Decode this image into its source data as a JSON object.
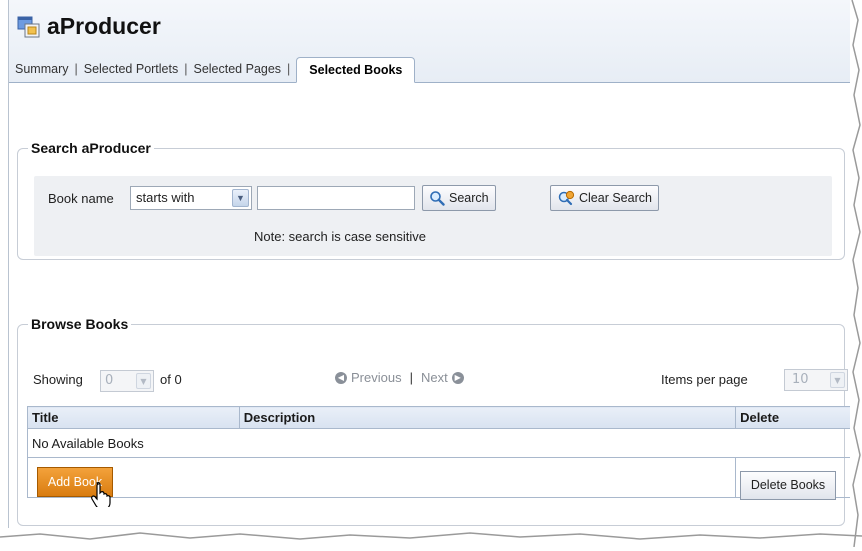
{
  "app": {
    "title": "aProducer",
    "icon": "application-icon"
  },
  "tabs": [
    {
      "label": "Summary",
      "active": false
    },
    {
      "label": "Selected Portlets",
      "active": false
    },
    {
      "label": "Selected Pages",
      "active": false
    },
    {
      "label": "Selected Books",
      "active": true
    }
  ],
  "search": {
    "legend": "Search aProducer",
    "field_label": "Book name",
    "match_mode": "starts with",
    "query_value": "",
    "search_label": "Search",
    "clear_label": "Clear Search",
    "note": "Note: search is case sensitive"
  },
  "browse": {
    "legend": "Browse Books",
    "showing_label": "Showing",
    "page_value": "0",
    "of_label": "of 0",
    "previous_label": "Previous",
    "separator": "|",
    "next_label": "Next",
    "items_per_page_label": "Items per page",
    "items_per_page_value": "10",
    "columns": {
      "title": "Title",
      "description": "Description",
      "delete": "Delete"
    },
    "empty_message": "No Available Books",
    "add_label": "Add Book",
    "delete_label": "Delete Books"
  },
  "colors": {
    "accent": "#e08a1e",
    "header_bg": "#e7edf5",
    "table_header": "#d8e2f0"
  }
}
